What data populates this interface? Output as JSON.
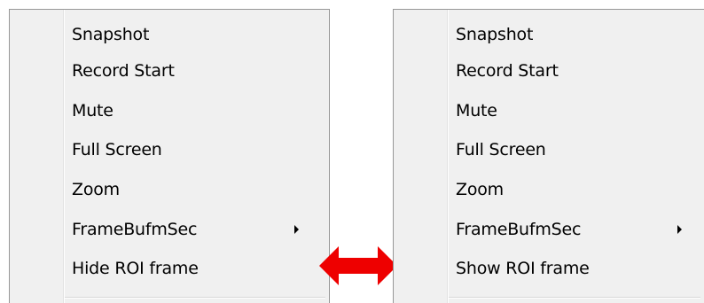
{
  "left_menu": {
    "items": [
      {
        "label": "Snapshot"
      },
      {
        "label": "Record Start"
      },
      {
        "label": "Mute"
      },
      {
        "label": "Full Screen"
      },
      {
        "label": "Zoom"
      },
      {
        "label": "FrameBufmSec",
        "has_submenu": true
      },
      {
        "label": "Hide ROI frame"
      }
    ]
  },
  "right_menu": {
    "items": [
      {
        "label": "Snapshot"
      },
      {
        "label": "Record Start"
      },
      {
        "label": "Mute"
      },
      {
        "label": "Full Screen"
      },
      {
        "label": "Zoom"
      },
      {
        "label": "FrameBufmSec",
        "has_submenu": true
      },
      {
        "label": "Show ROI frame"
      }
    ]
  },
  "annotation": {
    "icon": "double-headed-arrow-icon",
    "color": "#ee0000"
  },
  "colors": {
    "menu_background": "#f0f0f0",
    "menu_border": "#979797",
    "text": "#000000"
  }
}
